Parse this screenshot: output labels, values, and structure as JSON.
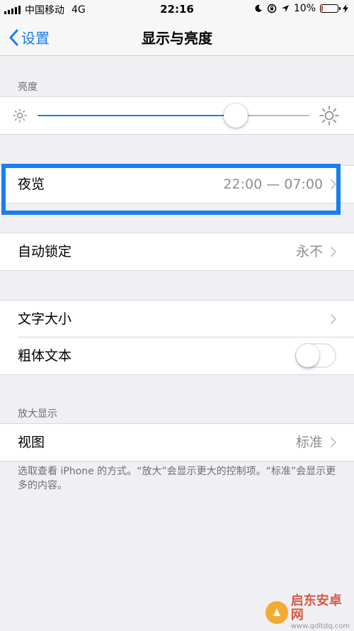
{
  "status_bar": {
    "carrier": "中国移动",
    "network": "4G",
    "time": "22:16",
    "battery": "10%",
    "battery_level": 0.1,
    "battery_color": "#e53935"
  },
  "nav": {
    "back_label": "设置",
    "title": "显示与亮度"
  },
  "brightness": {
    "header": "亮度",
    "level": 0.73,
    "accent": "#1a7df0"
  },
  "night_shift": {
    "label": "夜览",
    "value": "22:00 — 07:00"
  },
  "auto_lock": {
    "label": "自动锁定",
    "value": "永不"
  },
  "text_size": {
    "label": "文字大小"
  },
  "bold_text": {
    "label": "粗体文本",
    "enabled": false
  },
  "zoom": {
    "header": "放大显示",
    "view_label": "视图",
    "view_value": "标准",
    "note": "选取查看 iPhone 的方式。“放大”会显示更大的控制项。“标准”会显示更多的内容。"
  },
  "watermark": {
    "title": "启东安卓网",
    "url": "www.qdltdq.com"
  }
}
